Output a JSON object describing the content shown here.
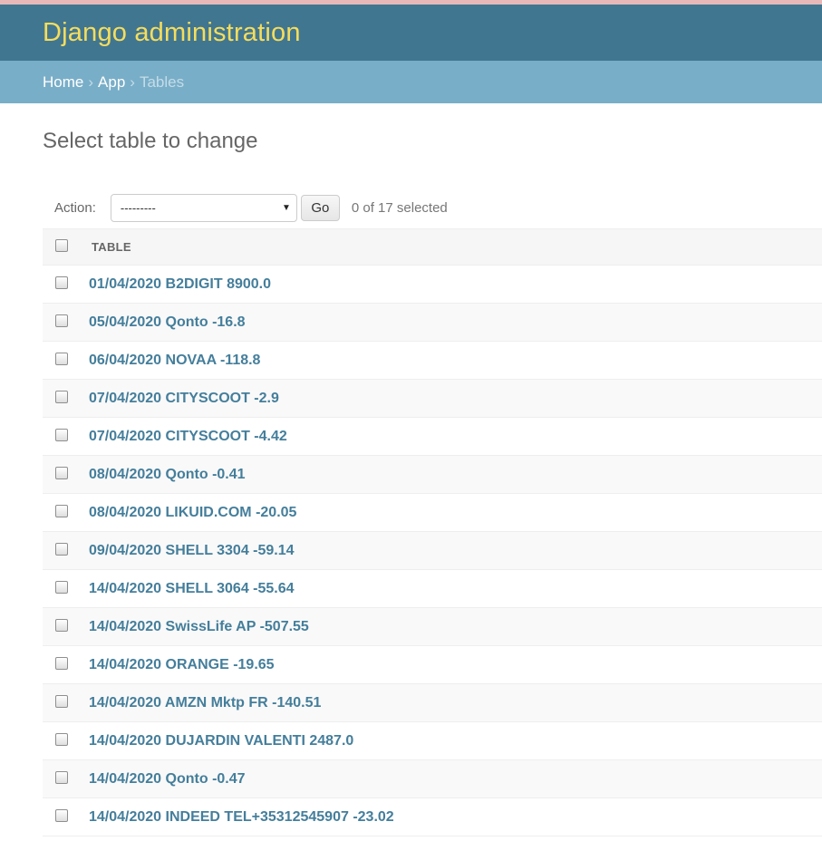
{
  "header": {
    "branding": "Django administration"
  },
  "breadcrumbs": {
    "home": "Home",
    "app": "App",
    "current": "Tables",
    "separator": "›"
  },
  "page": {
    "title": "Select table to change"
  },
  "actions": {
    "label": "Action:",
    "selected_value": "---------",
    "go_label": "Go",
    "selection_count": "0 of 17 selected"
  },
  "table": {
    "column_header": "TABLE",
    "rows": [
      "01/04/2020 B2DIGIT 8900.0",
      "05/04/2020 Qonto -16.8",
      "06/04/2020 NOVAA -118.8",
      "07/04/2020 CITYSCOOT -2.9",
      "07/04/2020 CITYSCOOT -4.42",
      "08/04/2020 Qonto -0.41",
      "08/04/2020 LIKUID.COM -20.05",
      "09/04/2020 SHELL 3304 -59.14",
      "14/04/2020 SHELL 3064 -55.64",
      "14/04/2020 SwissLife AP -507.55",
      "14/04/2020 ORANGE -19.65",
      "14/04/2020 AMZN Mktp FR -140.51",
      "14/04/2020 DUJARDIN VALENTI 2487.0",
      "14/04/2020 Qonto -0.47",
      "14/04/2020 INDEED TEL+35312545907 -23.02"
    ]
  },
  "colors": {
    "header_bg": "#417690",
    "branding_text": "#f5dd5d",
    "breadcrumbs_bg": "#79aec8",
    "link": "#447e9b"
  }
}
